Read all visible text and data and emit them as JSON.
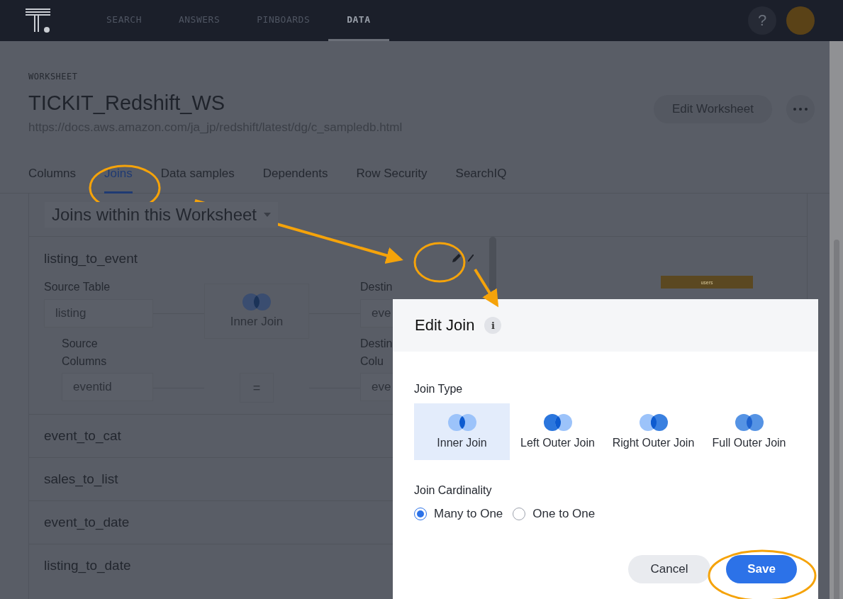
{
  "nav": {
    "items": [
      {
        "label": "SEARCH",
        "selected": false
      },
      {
        "label": "ANSWERS",
        "selected": false
      },
      {
        "label": "PINBOARDS",
        "selected": false
      },
      {
        "label": "DATA",
        "selected": true
      }
    ],
    "help": "?"
  },
  "header": {
    "eyebrow": "WORKSHEET",
    "title": "TICKIT_Redshift_WS",
    "url": "https://docs.aws.amazon.com/ja_jp/redshift/latest/dg/c_sampledb.html",
    "edit_button": "Edit Worksheet"
  },
  "tabs": [
    {
      "label": "Columns",
      "selected": false
    },
    {
      "label": "Joins",
      "selected": true
    },
    {
      "label": "Data samples",
      "selected": false
    },
    {
      "label": "Dependents",
      "selected": false
    },
    {
      "label": "Row Security",
      "selected": false
    },
    {
      "label": "SearchIQ",
      "selected": false
    }
  ],
  "joins_section": {
    "title": "Joins within this Worksheet",
    "joins": [
      {
        "name": "listing_to_event",
        "expanded": true,
        "source_table_label": "Source Table",
        "source_table": "listing",
        "join_type": "Inner Join",
        "destination_table_label": "Destin",
        "destination_table": "eve",
        "source_columns_label": "Source Columns",
        "source_column": "eventid",
        "operator": "=",
        "destination_columns_label": "Destin Colu",
        "destination_column": "eve"
      },
      {
        "name": "event_to_cat",
        "expanded": false
      },
      {
        "name": "sales_to_list",
        "expanded": false
      },
      {
        "name": "event_to_date",
        "expanded": false
      },
      {
        "name": "listing_to_date",
        "expanded": false
      }
    ],
    "diagram": {
      "table": "users"
    }
  },
  "dialog": {
    "title": "Edit Join",
    "info": "i",
    "join_type_label": "Join Type",
    "join_types": [
      {
        "label": "Inner Join",
        "kind": "inner",
        "selected": true
      },
      {
        "label": "Left Outer Join",
        "kind": "left",
        "selected": false
      },
      {
        "label": "Right Outer Join",
        "kind": "right",
        "selected": false
      },
      {
        "label": "Full Outer Join",
        "kind": "full",
        "selected": false
      }
    ],
    "cardinality_label": "Join Cardinality",
    "cardinalities": [
      {
        "label": "Many to One",
        "selected": true
      },
      {
        "label": "One to One",
        "selected": false
      }
    ],
    "buttons": [
      {
        "label": "Cancel",
        "kind": "secondary"
      },
      {
        "label": "Save",
        "kind": "primary"
      }
    ]
  }
}
